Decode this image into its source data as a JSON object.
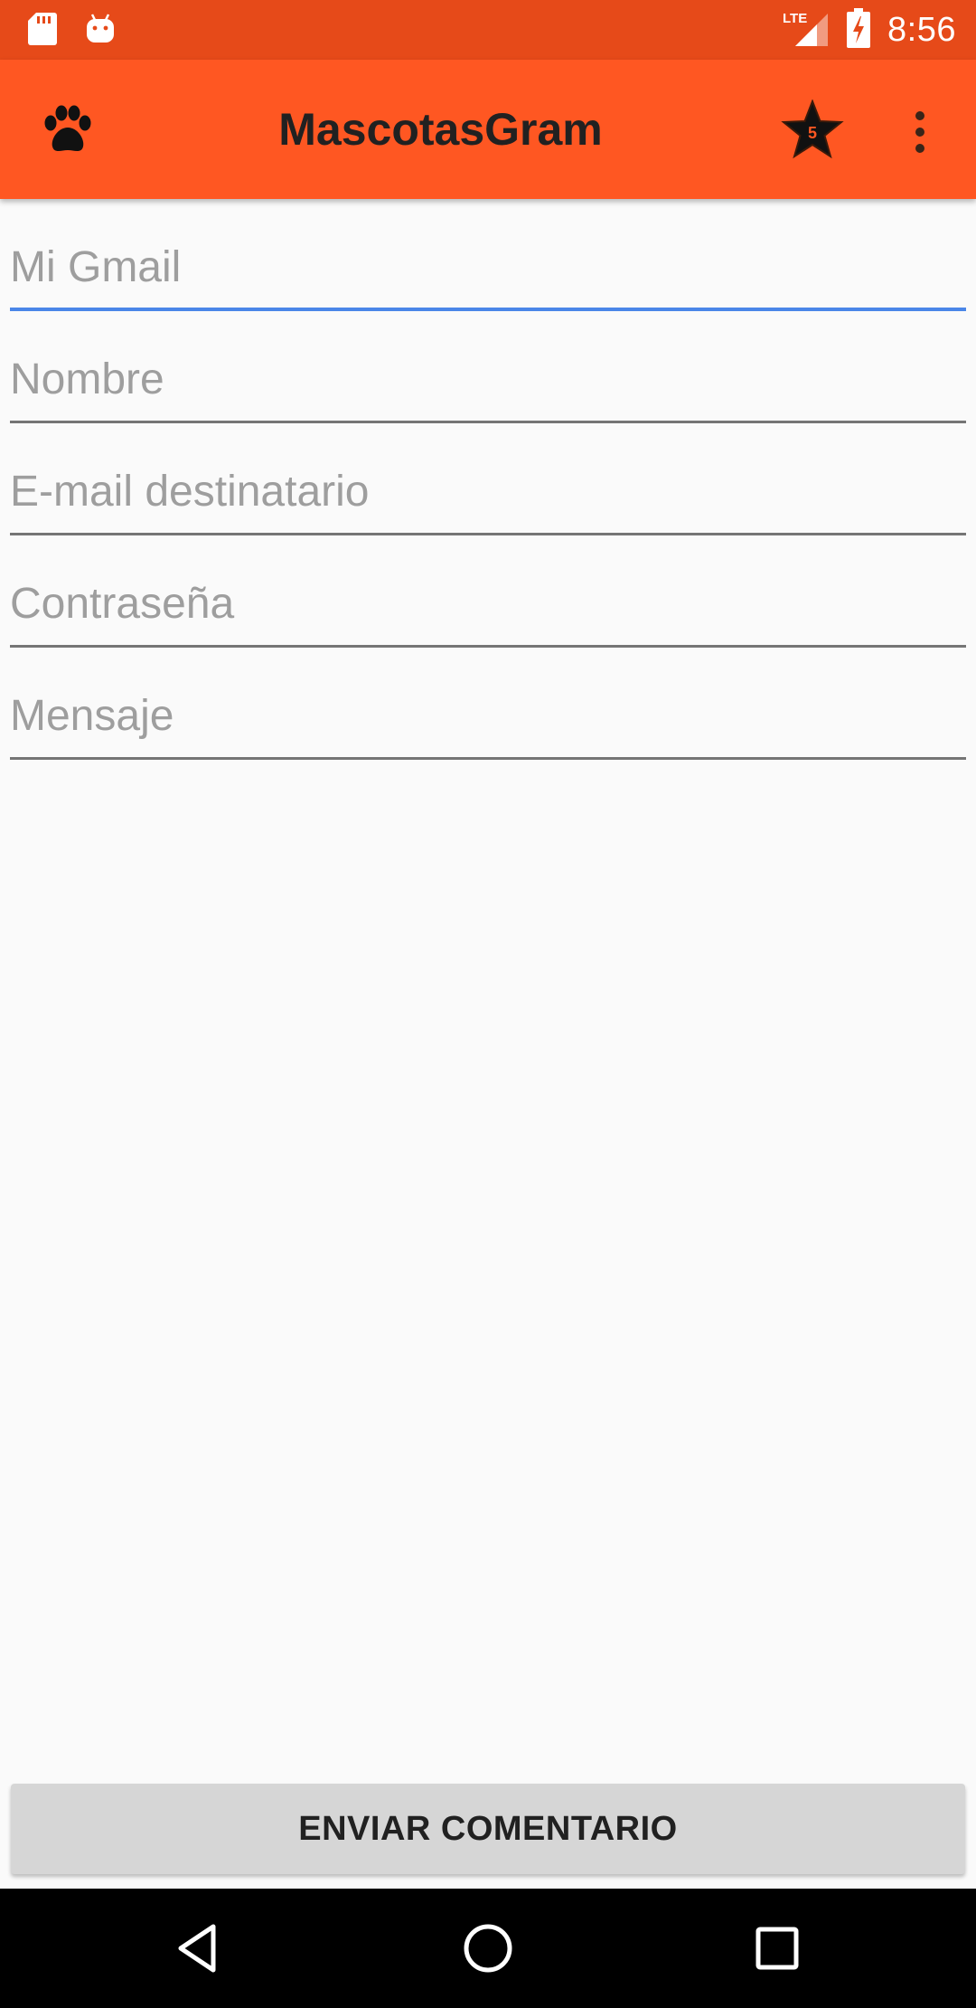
{
  "status_bar": {
    "time": "8:56",
    "network": "LTE",
    "icons": [
      "sd-card-icon",
      "android-icon",
      "signal-icon",
      "battery-charging-icon"
    ]
  },
  "app_bar": {
    "title": "MascotasGram",
    "star_badge": "5",
    "icons": [
      "paw-icon",
      "star-icon",
      "more-vert-icon"
    ]
  },
  "form": {
    "fields": [
      {
        "placeholder": "Mi Gmail",
        "value": ""
      },
      {
        "placeholder": "Nombre",
        "value": ""
      },
      {
        "placeholder": "E-mail destinatario",
        "value": ""
      },
      {
        "placeholder": "Contraseña",
        "value": ""
      },
      {
        "placeholder": "Mensaje",
        "value": ""
      }
    ],
    "submit_label": "ENVIAR COMENTARIO"
  },
  "colors": {
    "status_bar": "#e64a19",
    "app_bar": "#ff5722",
    "focused_underline": "#4a86e8",
    "button": "#d6d6d6"
  },
  "nav_bar": {
    "icons": [
      "back-icon",
      "home-icon",
      "recents-icon"
    ]
  }
}
